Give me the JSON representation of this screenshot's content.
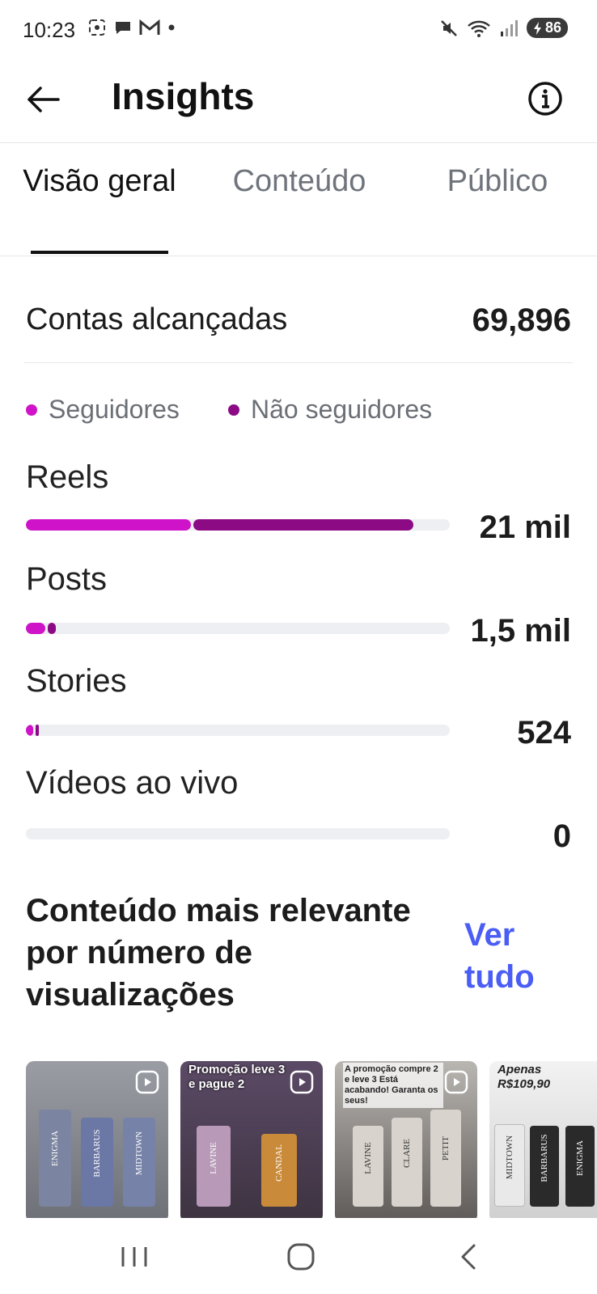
{
  "status_bar": {
    "time": "10:23",
    "battery": "86"
  },
  "header": {
    "title": "Insights"
  },
  "tabs": [
    {
      "label": "Visão geral",
      "active": true
    },
    {
      "label": "Conteúdo",
      "active": false
    },
    {
      "label": "Público",
      "active": false
    }
  ],
  "reach": {
    "label": "Contas alcançadas",
    "value": "69,896"
  },
  "legend": {
    "followers": "Seguidores",
    "non_followers": "Não seguidores"
  },
  "colors": {
    "followers": "#cf13c8",
    "non_followers": "#8d0a85",
    "accent": "#4a5df5"
  },
  "rows": [
    {
      "label": "Reels",
      "value": "21 mil",
      "followers_fraction": 0.39,
      "non_followers_fraction": 0.52
    },
    {
      "label": "Posts",
      "value": "1,5 mil",
      "followers_fraction": 0.045,
      "non_followers_fraction": 0.02
    },
    {
      "label": "Stories",
      "value": "524",
      "followers_fraction": 0.018,
      "non_followers_fraction": 0.008
    },
    {
      "label": "Vídeos ao vivo",
      "value": "0",
      "followers_fraction": 0,
      "non_followers_fraction": 0
    }
  ],
  "relevant": {
    "title": "Conteúdo mais relevante por número de visualizações",
    "see_all": "Ver tudo"
  },
  "thumbnails": [
    {
      "caption": "",
      "labels": [
        "ENIGMA",
        "BARBARUS",
        "MIDTOWN"
      ]
    },
    {
      "caption": "Promoção leve 3 e pague 2",
      "labels": [
        "LAVINE",
        "CANDAL"
      ]
    },
    {
      "caption": "A promoção compre 2 e leve 3 Está acabando! Garanta os seus!",
      "labels": [
        "LAVINE",
        "CLARE",
        "PETIT"
      ]
    },
    {
      "caption": "Apenas R$109,90",
      "labels": [
        "MIDTOWN",
        "BARBARUS",
        "ENIGMA"
      ]
    }
  ]
}
